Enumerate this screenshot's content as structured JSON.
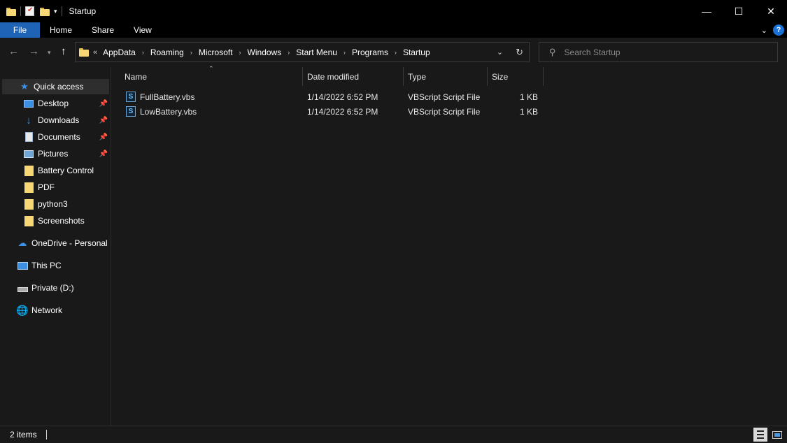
{
  "window": {
    "title": "Startup"
  },
  "window_buttons": {
    "minimize": "—",
    "maximize": "☐",
    "close": "✕"
  },
  "ribbon": {
    "tabs": [
      "File",
      "Home",
      "Share",
      "View"
    ],
    "help": "?"
  },
  "address": {
    "lead": "«",
    "crumbs": [
      "AppData",
      "Roaming",
      "Microsoft",
      "Windows",
      "Start Menu",
      "Programs",
      "Startup"
    ]
  },
  "search": {
    "placeholder": "Search Startup"
  },
  "nav": {
    "quick_access": "Quick access",
    "pinned": [
      "Desktop",
      "Downloads",
      "Documents",
      "Pictures"
    ],
    "folders": [
      "Battery Control",
      "PDF",
      "python3",
      "Screenshots"
    ],
    "onedrive": "OneDrive - Personal",
    "this_pc": "This PC",
    "drive": "Private (D:)",
    "network": "Network"
  },
  "columns": {
    "name": "Name",
    "date": "Date modified",
    "type": "Type",
    "size": "Size"
  },
  "files": [
    {
      "name": "FullBattery.vbs",
      "date": "1/14/2022 6:52 PM",
      "type": "VBScript Script File",
      "size": "1 KB"
    },
    {
      "name": "LowBattery.vbs",
      "date": "1/14/2022 6:52 PM",
      "type": "VBScript Script File",
      "size": "1 KB"
    }
  ],
  "status": {
    "items_count": "2 items"
  },
  "colors": {
    "file_tab": "#1f63b6",
    "background": "#191919",
    "selection": "#2e2e2e"
  }
}
